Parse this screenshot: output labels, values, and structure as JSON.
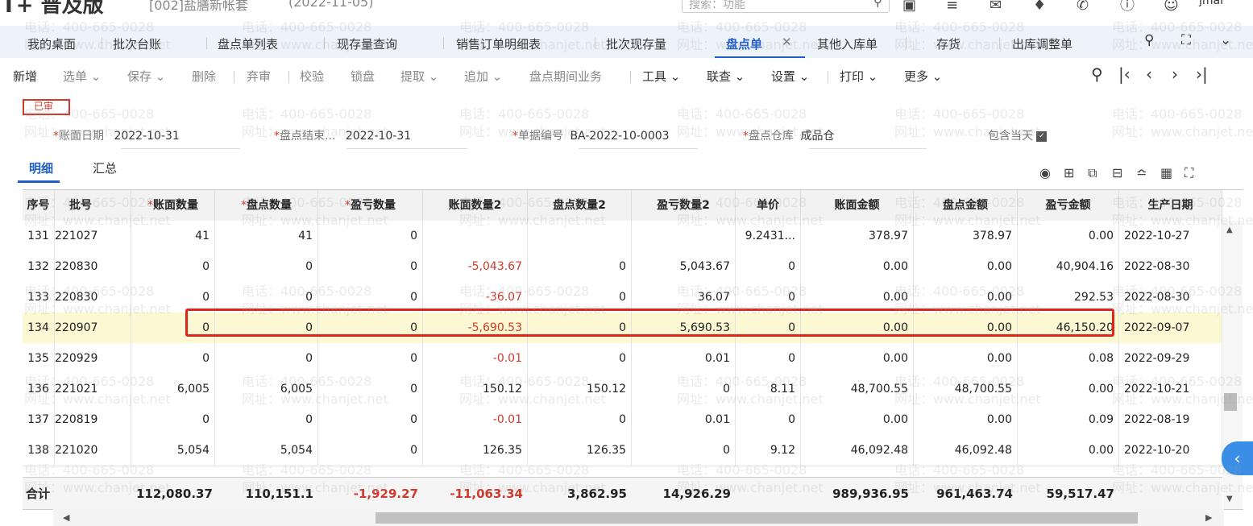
{
  "app": {
    "title": "T+ 普及版",
    "company": "[002]盐膳新帐套",
    "date": "(2022-11-05)"
  },
  "search": {
    "placeholder": "搜索：功能"
  },
  "user": "jmai",
  "tabs": [
    {
      "label": "我的桌面"
    },
    {
      "label": "批次台账"
    },
    {
      "label": "盘点单列表"
    },
    {
      "label": "现存量查询"
    },
    {
      "label": "销售订单明细表"
    },
    {
      "label": "批次现存量"
    },
    {
      "label": "盘点单"
    },
    {
      "label": "其他入库单"
    },
    {
      "label": "存货"
    },
    {
      "label": "出库调整单"
    }
  ],
  "toolbar": {
    "new": "新增",
    "select": "选单",
    "save": "保存",
    "delete": "删除",
    "abandon": "弃审",
    "check": "校验",
    "lock": "锁盘",
    "extract": "提取",
    "append": "追加",
    "period_business": "盘点期间业务",
    "tools": "工具",
    "link": "联查",
    "settings": "设置",
    "print": "打印",
    "more": "更多"
  },
  "status_badge": "已审",
  "form": {
    "account_date_label": "账面日期",
    "account_date_value": "2022-10-31",
    "end_date_label": "盘点结束...",
    "end_date_value": "2022-10-31",
    "doc_no_label": "单据编号",
    "doc_no_value": "BA-2022-10-0003",
    "warehouse_label": "盘点仓库",
    "warehouse_value": "成品仓",
    "include_today_label": "包含当天"
  },
  "subtabs": {
    "detail": "明细",
    "summary": "汇总"
  },
  "table": {
    "headers": [
      "序号",
      "批号",
      "账面数量",
      "盘点数量",
      "盈亏数量",
      "账面数量2",
      "盘点数量2",
      "盈亏数量2",
      "单价",
      "账面金额",
      "盘点金额",
      "盈亏金额",
      "生产日期"
    ],
    "rows": [
      [
        "131",
        "221027",
        "41",
        "41",
        "0",
        "",
        "",
        "",
        "9.2431...",
        "378.97",
        "378.97",
        "0.00",
        "2022-10-27"
      ],
      [
        "132",
        "220830",
        "0",
        "0",
        "0",
        "-5,043.67",
        "0",
        "5,043.67",
        "0",
        "0.00",
        "0.00",
        "40,904.16",
        "2022-08-30"
      ],
      [
        "133",
        "220830",
        "0",
        "0",
        "0",
        "-36.07",
        "0",
        "36.07",
        "0",
        "0.00",
        "0.00",
        "292.53",
        "2022-08-30"
      ],
      [
        "134",
        "220907",
        "0",
        "0",
        "0",
        "-5,690.53",
        "0",
        "5,690.53",
        "0",
        "0.00",
        "0.00",
        "46,150.20",
        "2022-09-07"
      ],
      [
        "135",
        "220929",
        "0",
        "0",
        "0",
        "-0.01",
        "0",
        "0.01",
        "0",
        "0.00",
        "0.00",
        "0.08",
        "2022-09-29"
      ],
      [
        "136",
        "221021",
        "6,005",
        "6,005",
        "0",
        "150.12",
        "150.12",
        "0",
        "8.11",
        "48,700.55",
        "48,700.55",
        "0.00",
        "2022-10-21"
      ],
      [
        "137",
        "220819",
        "0",
        "0",
        "0",
        "-0.01",
        "0",
        "0.01",
        "0",
        "0.00",
        "0.00",
        "0.09",
        "2022-08-19"
      ],
      [
        "138",
        "221020",
        "5,054",
        "5,054",
        "0",
        "126.35",
        "126.35",
        "0",
        "9.12",
        "46,092.48",
        "46,092.48",
        "0.00",
        "2022-10-20"
      ]
    ],
    "totals_label": "合计",
    "totals": [
      "112,080.37",
      "110,151.1",
      "-1,929.27",
      "-11,063.34",
      "3,862.95",
      "14,926.29",
      "989,936.95",
      "961,463.74",
      "59,517.47"
    ]
  },
  "watermark": {
    "phone": "电话：400-665-0028",
    "site": "网址：www.chanjet.net"
  },
  "colors": {
    "accent": "#1f5fc8",
    "negative": "#d0392b",
    "highlight": "#e2231a",
    "selected_row": "#fbf8d3"
  }
}
